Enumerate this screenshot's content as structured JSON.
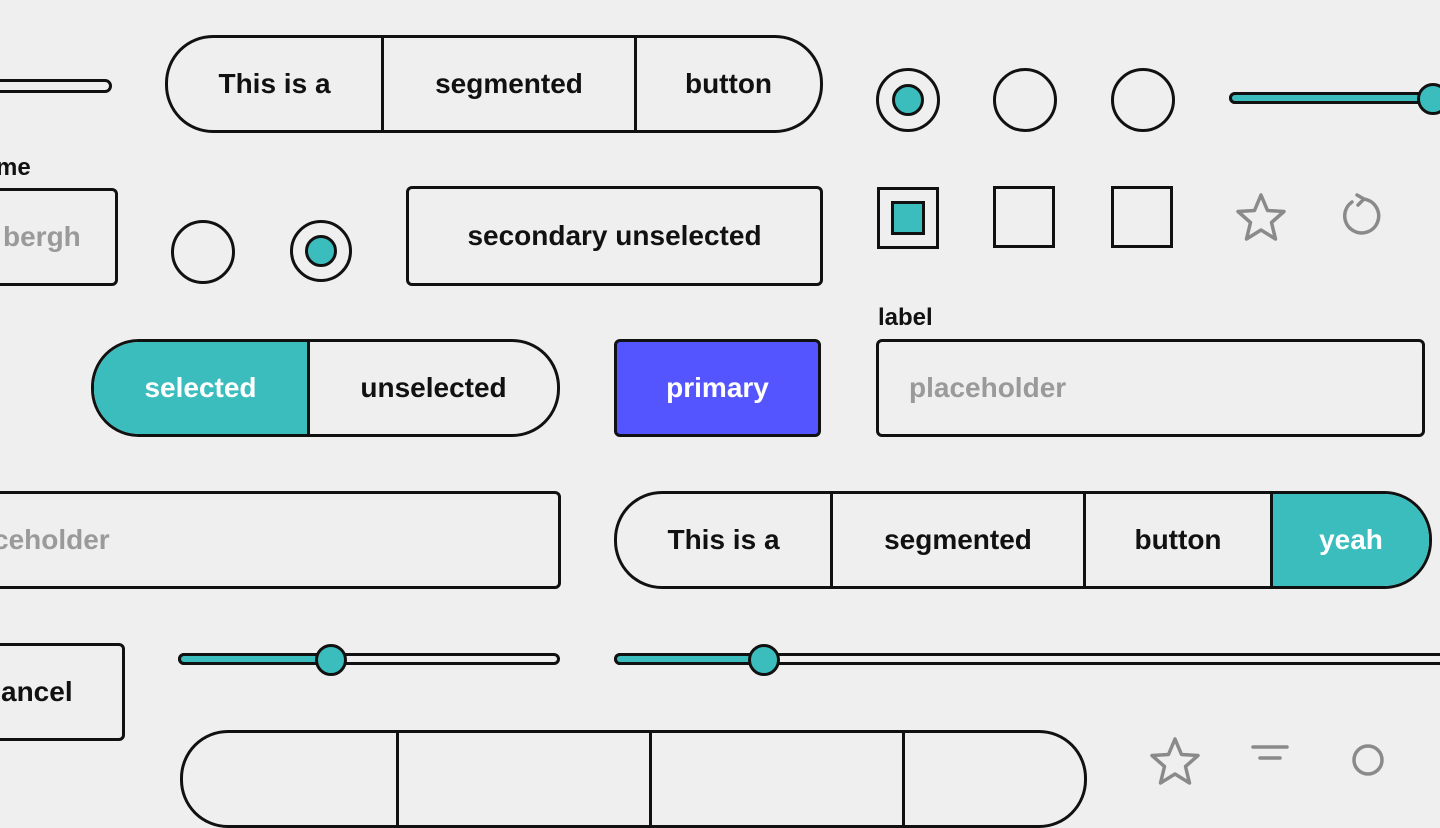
{
  "colors": {
    "accent": "#3bbdbd",
    "primary": "#5555ff",
    "placeholder": "#9a9a9a",
    "icon": "#8a8a8a"
  },
  "row1": {
    "segmented": [
      "This is a",
      "segmented",
      "button"
    ],
    "slider_value": 0.85
  },
  "row2": {
    "name_label_fragment": "me",
    "name_value_fragment": "bergh",
    "secondary_button": "secondary unselected",
    "icons": [
      "star-icon",
      "refresh-icon"
    ]
  },
  "row3": {
    "toggle": {
      "selected": "selected",
      "unselected": "unselected"
    },
    "primary_button": "primary",
    "field_label": "label",
    "field_placeholder": "placeholder"
  },
  "row4": {
    "placeholder_fragment": "ceholder",
    "segmented": [
      "This is a",
      "segmented",
      "button",
      "yeah"
    ]
  },
  "row5": {
    "cancel_fragment": "ancel",
    "slider_a_value": 0.4,
    "slider_b_value": 0.18
  },
  "row6": {
    "icons": [
      "star-icon",
      "filter-icon",
      "search-icon"
    ]
  }
}
